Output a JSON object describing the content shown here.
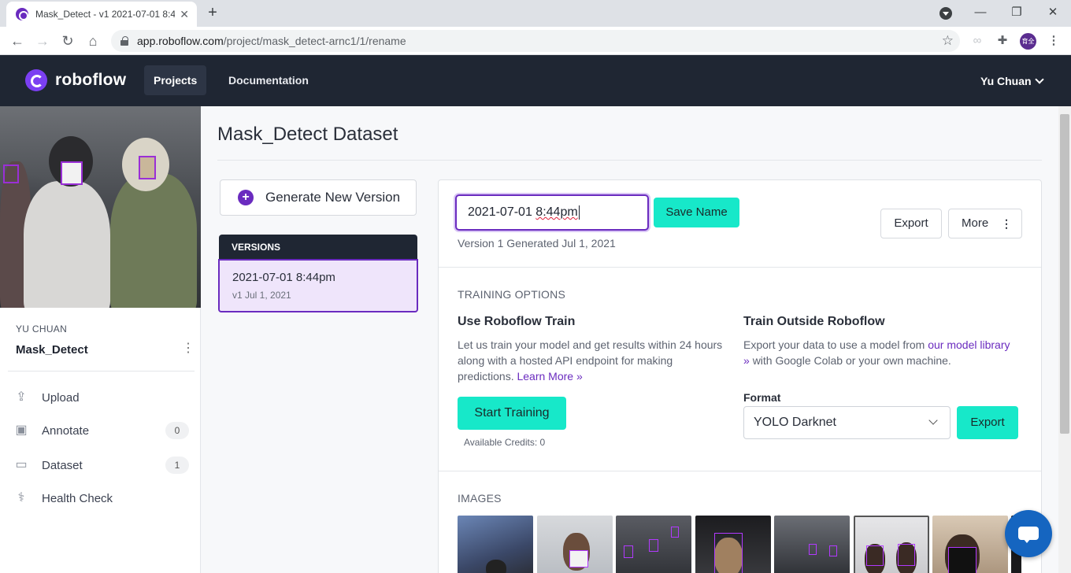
{
  "browser": {
    "tab_title": "Mask_Detect - v1 2021-07-01 8:44pm",
    "url_host": "app.roboflow.com",
    "url_path": "/project/mask_detect-arnc1/1/rename",
    "profile_initials": "育全"
  },
  "header": {
    "brand": "roboflow",
    "nav": [
      {
        "label": "Projects",
        "active": true
      },
      {
        "label": "Documentation",
        "active": false
      }
    ],
    "user": "Yu Chuan"
  },
  "sidebar": {
    "workspace": "YU CHUAN",
    "project": "Mask_Detect",
    "items": [
      {
        "label": "Upload",
        "icon": "upload-icon",
        "count": ""
      },
      {
        "label": "Annotate",
        "icon": "annotate-icon",
        "count": "0"
      },
      {
        "label": "Dataset",
        "icon": "dataset-icon",
        "count": "1"
      },
      {
        "label": "Health Check",
        "icon": "stethoscope-icon",
        "count": ""
      }
    ]
  },
  "main": {
    "title": "Mask_Detect Dataset",
    "generate_label": "Generate New Version",
    "versions_header": "VERSIONS",
    "versions": [
      {
        "name": "2021-07-01 8:44pm",
        "sub": "v1 Jul 1, 2021"
      }
    ]
  },
  "version_panel": {
    "rename_value_date": "2021-07-01 ",
    "rename_value_time": "8:44pm",
    "save_label": "Save Name",
    "generated_info": "Version 1 Generated Jul 1, 2021",
    "export_label": "Export",
    "more_label": "More",
    "training": {
      "caption": "TRAINING OPTIONS",
      "left_heading": "Use Roboflow Train",
      "left_text": "Let us train your model and get results within 24 hours along with a hosted API endpoint for making predictions.",
      "learn_more": "Learn More »",
      "start_label": "Start Training",
      "credits": "Available Credits: 0",
      "right_heading": "Train Outside Roboflow",
      "right_text_before": "Export your data to use a model from",
      "right_link": "our model library »",
      "right_text_after": "with Google Colab or your own machine.",
      "format_label": "Format",
      "format_value": "YOLO Darknet",
      "export_label": "Export"
    },
    "images_caption": "IMAGES"
  },
  "colors": {
    "accent_purple": "#6a2bbf",
    "accent_teal": "#17e8c9",
    "header_bg": "#1f2633"
  }
}
